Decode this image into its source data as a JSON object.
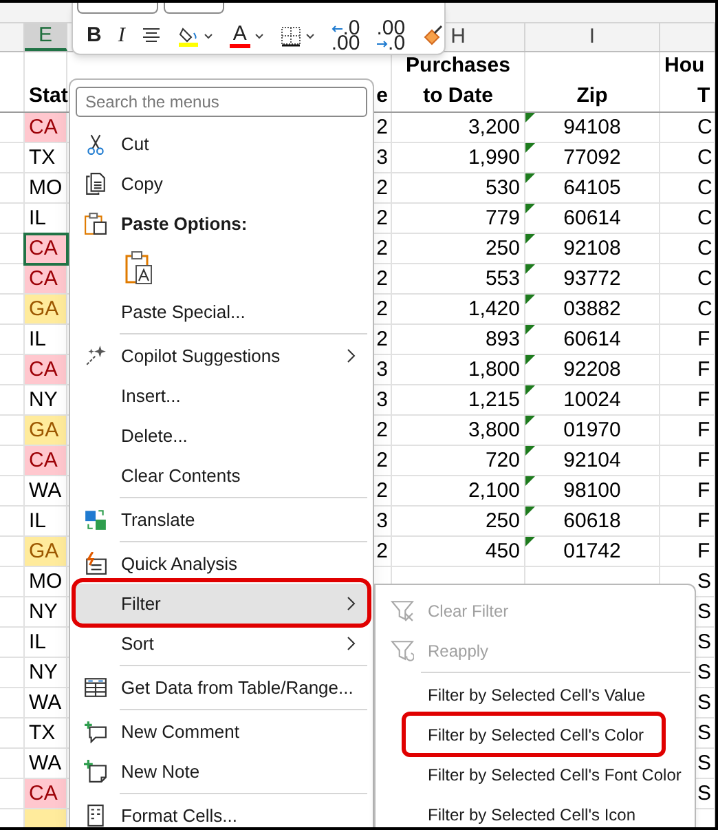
{
  "toolbar": {
    "buttons": [
      {
        "kind": "bold",
        "label": "B"
      },
      {
        "kind": "italic",
        "label": "I"
      },
      {
        "kind": "align"
      },
      {
        "kind": "fill_color"
      },
      {
        "kind": "font_color",
        "label": "A"
      },
      {
        "kind": "borders"
      },
      {
        "kind": "increase_decimal",
        "top": ".0",
        "bottom": ".00"
      },
      {
        "kind": "decrease_decimal",
        "top": ".00",
        "bottom": ".0"
      },
      {
        "kind": "format_painter"
      }
    ]
  },
  "column_headers": [
    {
      "label": "E",
      "selected": true
    },
    {
      "label": "H",
      "selected": false
    },
    {
      "label": "I",
      "selected": false
    }
  ],
  "sheet": {
    "header": {
      "column_e": "Stat",
      "column_g": "e",
      "purchases_to_date": [
        "Purchases",
        "to Date"
      ],
      "zip": "Zip",
      "column_j": [
        "Hou",
        "T"
      ]
    },
    "rows": [
      {
        "column_e": "CA",
        "color": "#ffc7ce",
        "selected": false,
        "column_g": "2",
        "purchases_to_date": "3,200",
        "zip": "94108",
        "number_as_text": true,
        "column_j": "C"
      },
      {
        "column_e": "TX",
        "color": "#ffffff",
        "selected": false,
        "column_g": "3",
        "purchases_to_date": "1,990",
        "zip": "77092",
        "number_as_text": true,
        "column_j": "C"
      },
      {
        "column_e": "MO",
        "color": "#ffffff",
        "selected": false,
        "column_g": "2",
        "purchases_to_date": "530",
        "zip": "64105",
        "number_as_text": true,
        "column_j": "C"
      },
      {
        "column_e": "IL",
        "color": "#ffffff",
        "selected": false,
        "column_g": "2",
        "purchases_to_date": "779",
        "zip": "60614",
        "number_as_text": true,
        "column_j": "C"
      },
      {
        "column_e": "CA",
        "color": "#ffc7ce",
        "selected": true,
        "column_g": "2",
        "purchases_to_date": "250",
        "zip": "92108",
        "number_as_text": true,
        "column_j": "C"
      },
      {
        "column_e": "CA",
        "color": "#ffc7ce",
        "selected": false,
        "column_g": "2",
        "purchases_to_date": "553",
        "zip": "93772",
        "number_as_text": true,
        "column_j": "C"
      },
      {
        "column_e": "GA",
        "color": "#ffeb9c",
        "selected": false,
        "column_g": "2",
        "purchases_to_date": "1,420",
        "zip": "03882",
        "number_as_text": true,
        "column_j": "C"
      },
      {
        "column_e": "IL",
        "color": "#ffffff",
        "selected": false,
        "column_g": "2",
        "purchases_to_date": "893",
        "zip": "60614",
        "number_as_text": true,
        "column_j": "F"
      },
      {
        "column_e": "CA",
        "color": "#ffc7ce",
        "selected": false,
        "column_g": "3",
        "purchases_to_date": "1,800",
        "zip": "92208",
        "number_as_text": true,
        "column_j": "F"
      },
      {
        "column_e": "NY",
        "color": "#ffffff",
        "selected": false,
        "column_g": "3",
        "purchases_to_date": "1,215",
        "zip": "10024",
        "number_as_text": true,
        "column_j": "F"
      },
      {
        "column_e": "GA",
        "color": "#ffeb9c",
        "selected": false,
        "column_g": "2",
        "purchases_to_date": "3,800",
        "zip": "01970",
        "number_as_text": true,
        "column_j": "F"
      },
      {
        "column_e": "CA",
        "color": "#ffc7ce",
        "selected": false,
        "column_g": "2",
        "purchases_to_date": "720",
        "zip": "92104",
        "number_as_text": true,
        "column_j": "F"
      },
      {
        "column_e": "WA",
        "color": "#ffffff",
        "selected": false,
        "column_g": "2",
        "purchases_to_date": "2,100",
        "zip": "98100",
        "number_as_text": true,
        "column_j": "F"
      },
      {
        "column_e": "IL",
        "color": "#ffffff",
        "selected": false,
        "column_g": "3",
        "purchases_to_date": "250",
        "zip": "60618",
        "number_as_text": true,
        "column_j": "F"
      },
      {
        "column_e": "GA",
        "color": "#ffeb9c",
        "selected": false,
        "column_g": "2",
        "purchases_to_date": "450",
        "zip": "01742",
        "number_as_text": true,
        "column_j": "F"
      },
      {
        "column_e": "MO",
        "color": "#ffffff",
        "selected": false,
        "column_j": "S"
      },
      {
        "column_e": "NY",
        "color": "#ffffff",
        "selected": false,
        "column_j": "S"
      },
      {
        "column_e": "IL",
        "color": "#ffffff",
        "selected": false,
        "column_j": "S"
      },
      {
        "column_e": "NY",
        "color": "#ffffff",
        "selected": false,
        "column_j": "S"
      },
      {
        "column_e": "WA",
        "color": "#ffffff",
        "selected": false,
        "column_j": "S"
      },
      {
        "column_e": "TX",
        "color": "#ffffff",
        "selected": false,
        "column_j": "S"
      },
      {
        "column_e": "WA",
        "color": "#ffffff",
        "selected": false,
        "column_j": "S"
      },
      {
        "column_e": "CA",
        "color": "#ffc7ce",
        "selected": false,
        "column_j": "S"
      },
      {
        "color": "#ffeb9c",
        "selected": false
      }
    ]
  },
  "context_menu": {
    "search": {
      "placeholder": "Search the menus"
    },
    "items": [
      {
        "kind": "item",
        "label": "Cut",
        "submenu": false,
        "highlighted": false,
        "callout": false
      },
      {
        "kind": "item",
        "label": "Copy",
        "submenu": false,
        "highlighted": false,
        "callout": false
      },
      {
        "kind": "heading",
        "label": "Paste Options:"
      },
      {
        "kind": "paste_buttons"
      },
      {
        "kind": "item",
        "label": "Paste Special...",
        "submenu": false,
        "highlighted": false,
        "callout": false
      },
      {
        "kind": "separator"
      },
      {
        "kind": "item",
        "label": "Copilot Suggestions",
        "submenu": true,
        "highlighted": false,
        "callout": false
      },
      {
        "kind": "item",
        "label": "Insert...",
        "submenu": false,
        "highlighted": false,
        "callout": false
      },
      {
        "kind": "item",
        "label": "Delete...",
        "submenu": false,
        "highlighted": false,
        "callout": false
      },
      {
        "kind": "item",
        "label": "Clear Contents",
        "submenu": false,
        "highlighted": false,
        "callout": false
      },
      {
        "kind": "separator"
      },
      {
        "kind": "item",
        "label": "Translate",
        "submenu": false,
        "highlighted": false,
        "callout": false
      },
      {
        "kind": "separator"
      },
      {
        "kind": "item",
        "label": "Quick Analysis",
        "submenu": false,
        "highlighted": false,
        "callout": false
      },
      {
        "kind": "item",
        "label": "Filter",
        "submenu": true,
        "highlighted": true,
        "callout": true
      },
      {
        "kind": "item",
        "label": "Sort",
        "submenu": true,
        "highlighted": false,
        "callout": false
      },
      {
        "kind": "separator"
      },
      {
        "kind": "item",
        "label": "Get Data from Table/Range...",
        "submenu": false,
        "highlighted": false,
        "callout": false
      },
      {
        "kind": "separator"
      },
      {
        "kind": "item",
        "label": "New Comment",
        "submenu": false,
        "highlighted": false,
        "callout": false
      },
      {
        "kind": "item",
        "label": "New Note",
        "submenu": false,
        "highlighted": false,
        "callout": false
      },
      {
        "kind": "separator"
      },
      {
        "kind": "item",
        "label": "Format Cells...",
        "submenu": false,
        "highlighted": false,
        "callout": false
      }
    ]
  },
  "filter_submenu": {
    "items": [
      {
        "kind": "item",
        "label": "Clear Filter",
        "disabled": true,
        "callout": false
      },
      {
        "kind": "item",
        "label": "Reapply",
        "disabled": true,
        "callout": false
      },
      {
        "kind": "separator"
      },
      {
        "kind": "item",
        "label": "Filter by Selected Cell's Value",
        "disabled": false,
        "callout": false
      },
      {
        "kind": "item",
        "label": "Filter by Selected Cell's Color",
        "disabled": false,
        "callout": true
      },
      {
        "kind": "item",
        "label": "Filter by Selected Cell's Font Color",
        "disabled": false,
        "callout": false
      },
      {
        "kind": "item",
        "label": "Filter by Selected Cell's Icon",
        "disabled": false,
        "callout": false
      }
    ]
  }
}
